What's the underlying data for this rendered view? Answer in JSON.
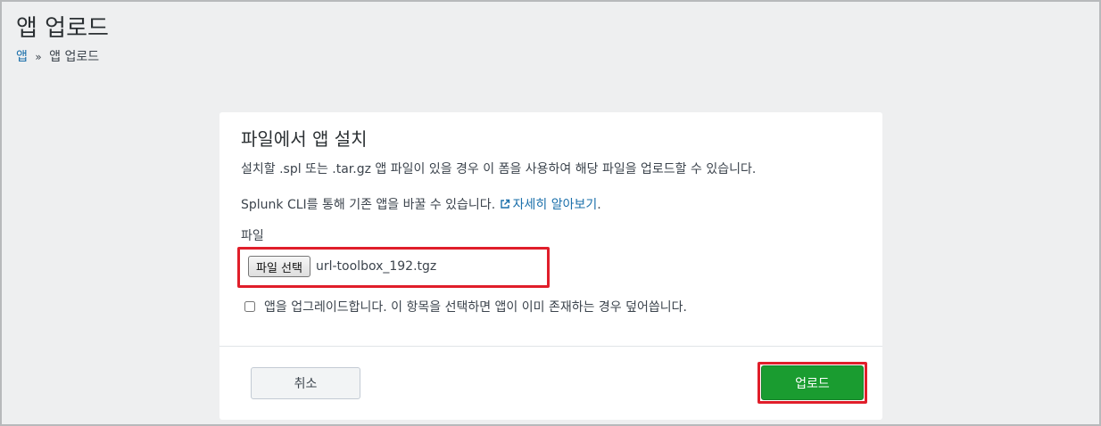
{
  "page": {
    "title": "앱 업로드"
  },
  "breadcrumb": {
    "parent": "앱",
    "separator": "»",
    "current": "앱 업로드"
  },
  "card": {
    "title": "파일에서 앱 설치",
    "help_line_1": "설치할 .spl 또는 .tar.gz 앱 파일이 있을 경우 이 폼을 사용하여 해당 파일을 업로드할 수 있습니다.",
    "help_line_2": "Splunk CLI를 통해 기존 앱을 바꿀 수 있습니다.",
    "learn_more": "자세히 알아보기",
    "learn_more_suffix": ".",
    "learn_more_icon": "external-link-icon",
    "file_label": "파일",
    "file_choose_button": "파일 선택",
    "file_name": "url-toolbox_192.tgz",
    "upgrade_label": "앱을 업그레이드합니다. 이 항목을 선택하면 앱이 이미 존재하는 경우 덮어씁니다.",
    "upgrade_checked": false,
    "cancel_label": "취소",
    "upload_label": "업로드"
  },
  "colors": {
    "background": "#eeeff0",
    "link": "#1a6faa",
    "primary_button": "#1a9c30",
    "highlight": "#e01e2a"
  }
}
